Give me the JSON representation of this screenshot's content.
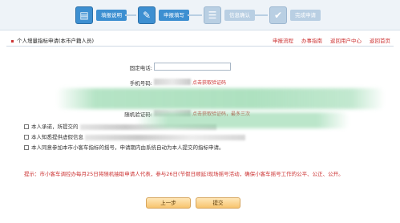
{
  "steps": [
    {
      "label": "填报说明",
      "icon": "document-icon",
      "active": true
    },
    {
      "label": "申报填写",
      "icon": "edit-icon",
      "active": true
    },
    {
      "label": "信息确认",
      "icon": "form-icon",
      "active": false
    },
    {
      "label": "完成申请",
      "icon": "check-icon",
      "active": false
    }
  ],
  "header": {
    "title": "个人增量指标申请(本市户籍人员)",
    "links": [
      "申报流程",
      "办事指南",
      "返回用户中心",
      "返回首页"
    ]
  },
  "form": {
    "landline_label": "固定电话:",
    "landline_value": "",
    "mobile_label": "手机号码:",
    "mobile_hint": "点击获取验证码",
    "captcha_label": "随机验证码:",
    "captcha_hint": "点击获取验证码，最多三次"
  },
  "notes": {
    "pledge_prefix": "本人承诺，所提交的",
    "info_prefix": "本人知悉提供虚假信息",
    "consent_text": "本人同意参加本市小客车指标的摇号，申请期内由系统自动为本人提交的指标申请。"
  },
  "notice": "提示：市小客车调控办每月25日将随机抽取申请人代表，参与26日(节假日顺延)现场摇号活动，确保小客车摇号工作的公平、公正、公开。",
  "actions": {
    "prev_label": "上一步",
    "submit_label": "提交"
  }
}
